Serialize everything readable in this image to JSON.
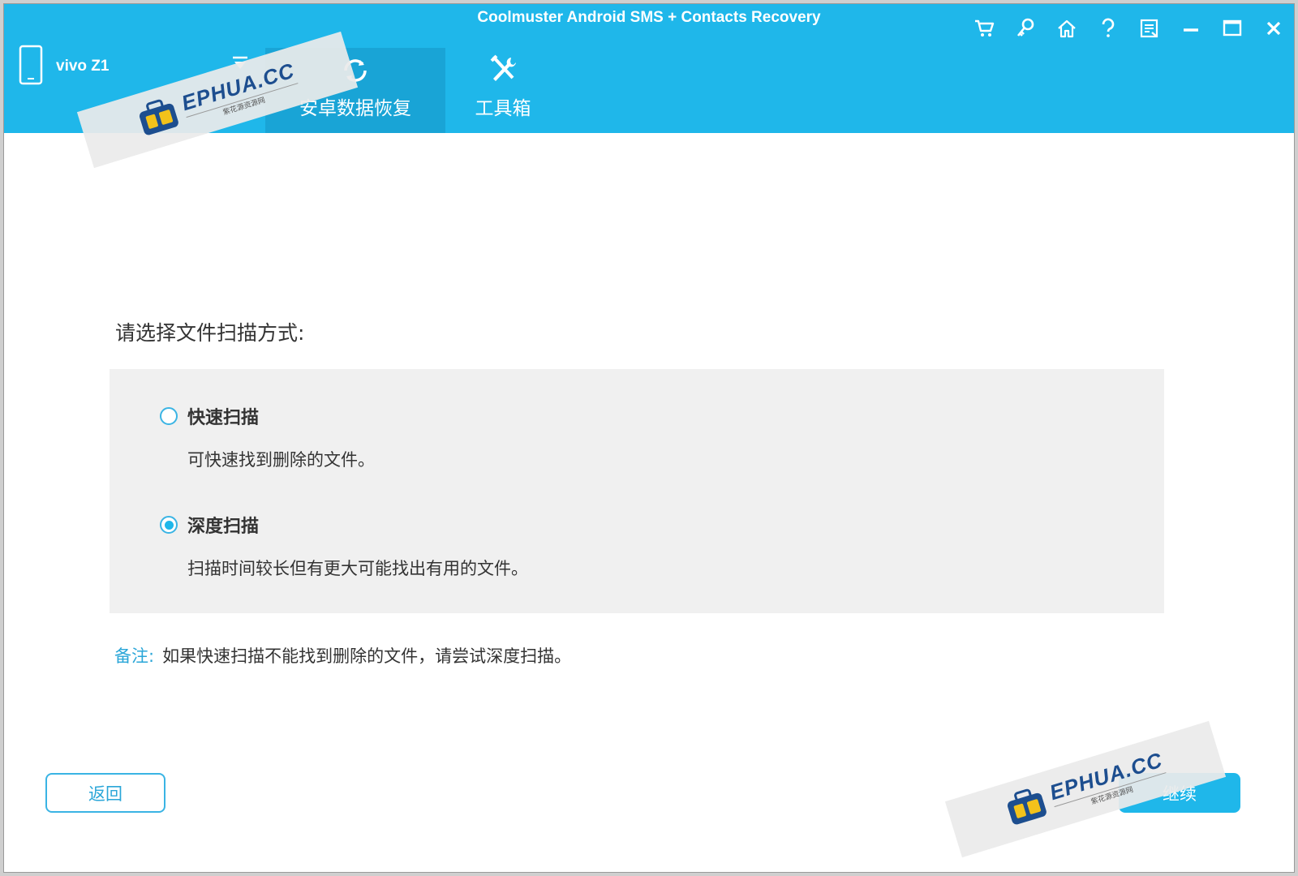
{
  "window": {
    "title": "Coolmuster Android SMS + Contacts Recovery",
    "controls": [
      {
        "name": "cart-icon"
      },
      {
        "name": "key-icon"
      },
      {
        "name": "home-icon"
      },
      {
        "name": "help-icon"
      },
      {
        "name": "feedback-icon"
      },
      {
        "name": "minimize-icon"
      },
      {
        "name": "maximize-icon"
      },
      {
        "name": "close-icon"
      }
    ]
  },
  "device": {
    "name": "vivo Z1",
    "icon": "phone-icon"
  },
  "tabs": [
    {
      "label": "安卓数据恢复",
      "icon": "recovery-icon",
      "active": true
    },
    {
      "label": "工具箱",
      "icon": "tools-icon",
      "active": false
    }
  ],
  "main": {
    "prompt": "请选择文件扫描方式:",
    "options": [
      {
        "label": "快速扫描",
        "description": "可快速找到删除的文件。",
        "selected": false
      },
      {
        "label": "深度扫描",
        "description": "扫描时间较长但有更大可能找出有用的文件。",
        "selected": true
      }
    ],
    "note_label": "备注:",
    "note_text": "如果快速扫描不能找到删除的文件，请尝试深度扫描。"
  },
  "buttons": {
    "back": "返回",
    "continue": "继续"
  },
  "watermark": {
    "text": "EPHUA.CC",
    "subtext": "紫花源资源网"
  },
  "colors": {
    "accent": "#1fb7ea",
    "active_tab": "#19a4d6",
    "panel": "#f0f0f0"
  }
}
